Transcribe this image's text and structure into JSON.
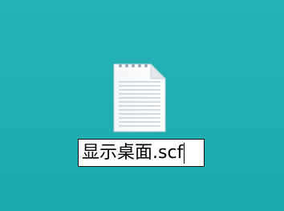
{
  "desktop": {
    "background_color": "#22b0b3"
  },
  "file": {
    "icon": "document-file-icon",
    "name_edit_value": "显示桌面.scf",
    "editing": true
  }
}
